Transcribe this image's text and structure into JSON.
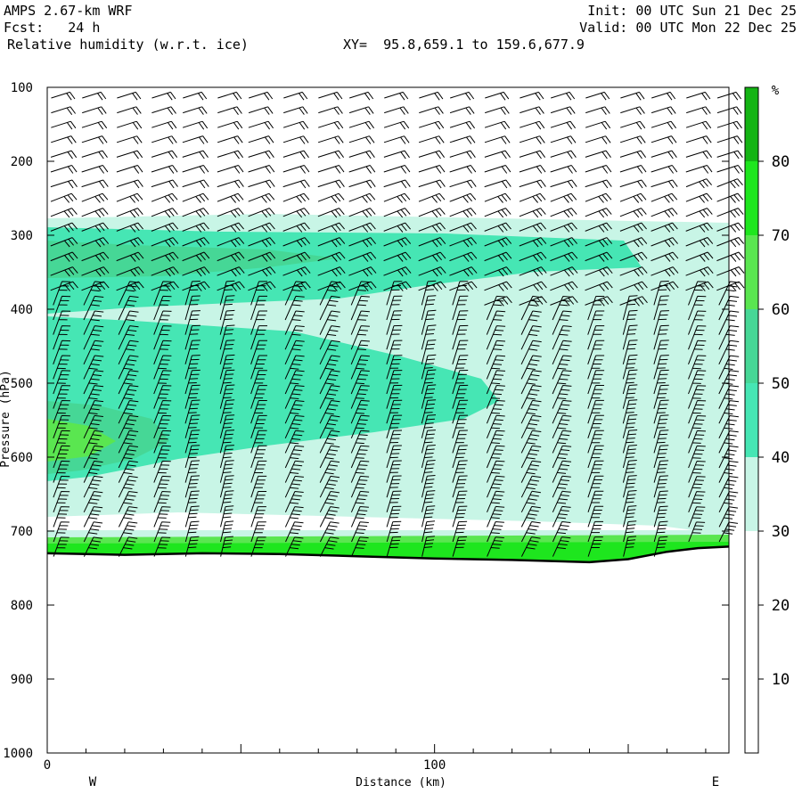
{
  "header": {
    "model": "AMPS 2.67-km WRF",
    "init": "Init: 00 UTC Sun 21 Dec 25",
    "fcst": "Fcst:   24 h",
    "valid": "Valid: 00 UTC Mon 22 Dec 25",
    "field": "Relative humidity (w.r.t. ice)",
    "xy": "XY=  95.8,659.1 to 159.6,677.9"
  },
  "chart_data": {
    "type": "heatmap",
    "title": "Relative humidity (w.r.t. ice)",
    "xlabel": "Distance (km)",
    "ylabel": "Pressure (hPa)",
    "xlim": [
      0,
      176
    ],
    "ylim": [
      1000,
      100
    ],
    "x_ticks": [
      "0",
      "100"
    ],
    "x_tick_values": [
      0,
      100
    ],
    "y_ticks": [
      "100",
      "200",
      "300",
      "400",
      "500",
      "600",
      "700",
      "800",
      "900",
      "1000"
    ],
    "y_tick_values": [
      100,
      200,
      300,
      400,
      500,
      600,
      700,
      800,
      900,
      1000
    ],
    "left_end_label": "W",
    "right_end_label": "E",
    "colorbar": {
      "unit": "%",
      "levels": [
        10,
        20,
        30,
        40,
        50,
        60,
        70,
        80
      ],
      "colors": [
        "#ffffff",
        "#ffffff",
        "#ffffff",
        "#c8f5e6",
        "#46e6b4",
        "#46d796",
        "#5ae650",
        "#1ee61e",
        "#14b414"
      ]
    },
    "rh_regions": [
      {
        "band": "30-40",
        "description_pressure_top": 270,
        "color": "#c8f5e6"
      },
      {
        "band": "40-50",
        "color": "#46e6b4"
      },
      {
        "band": "50-60",
        "color": "#46d796"
      },
      {
        "band": "60-70",
        "color": "#5ae650"
      },
      {
        "band": "70-80",
        "color": "#1ee61e"
      }
    ],
    "terrain_pressure": [
      {
        "x": 0,
        "p": 730
      },
      {
        "x": 20,
        "p": 732
      },
      {
        "x": 40,
        "p": 730
      },
      {
        "x": 60,
        "p": 731
      },
      {
        "x": 80,
        "p": 734
      },
      {
        "x": 100,
        "p": 737
      },
      {
        "x": 120,
        "p": 739
      },
      {
        "x": 140,
        "p": 742
      },
      {
        "x": 150,
        "p": 738
      },
      {
        "x": 160,
        "p": 728
      },
      {
        "x": 168,
        "p": 723
      },
      {
        "x": 176,
        "p": 721
      }
    ],
    "wind_barb_columns_km": [
      2,
      10,
      19,
      28,
      36,
      45,
      53,
      62,
      71,
      79,
      88,
      97,
      105,
      114,
      123,
      131,
      140,
      149,
      157,
      166,
      174
    ]
  }
}
